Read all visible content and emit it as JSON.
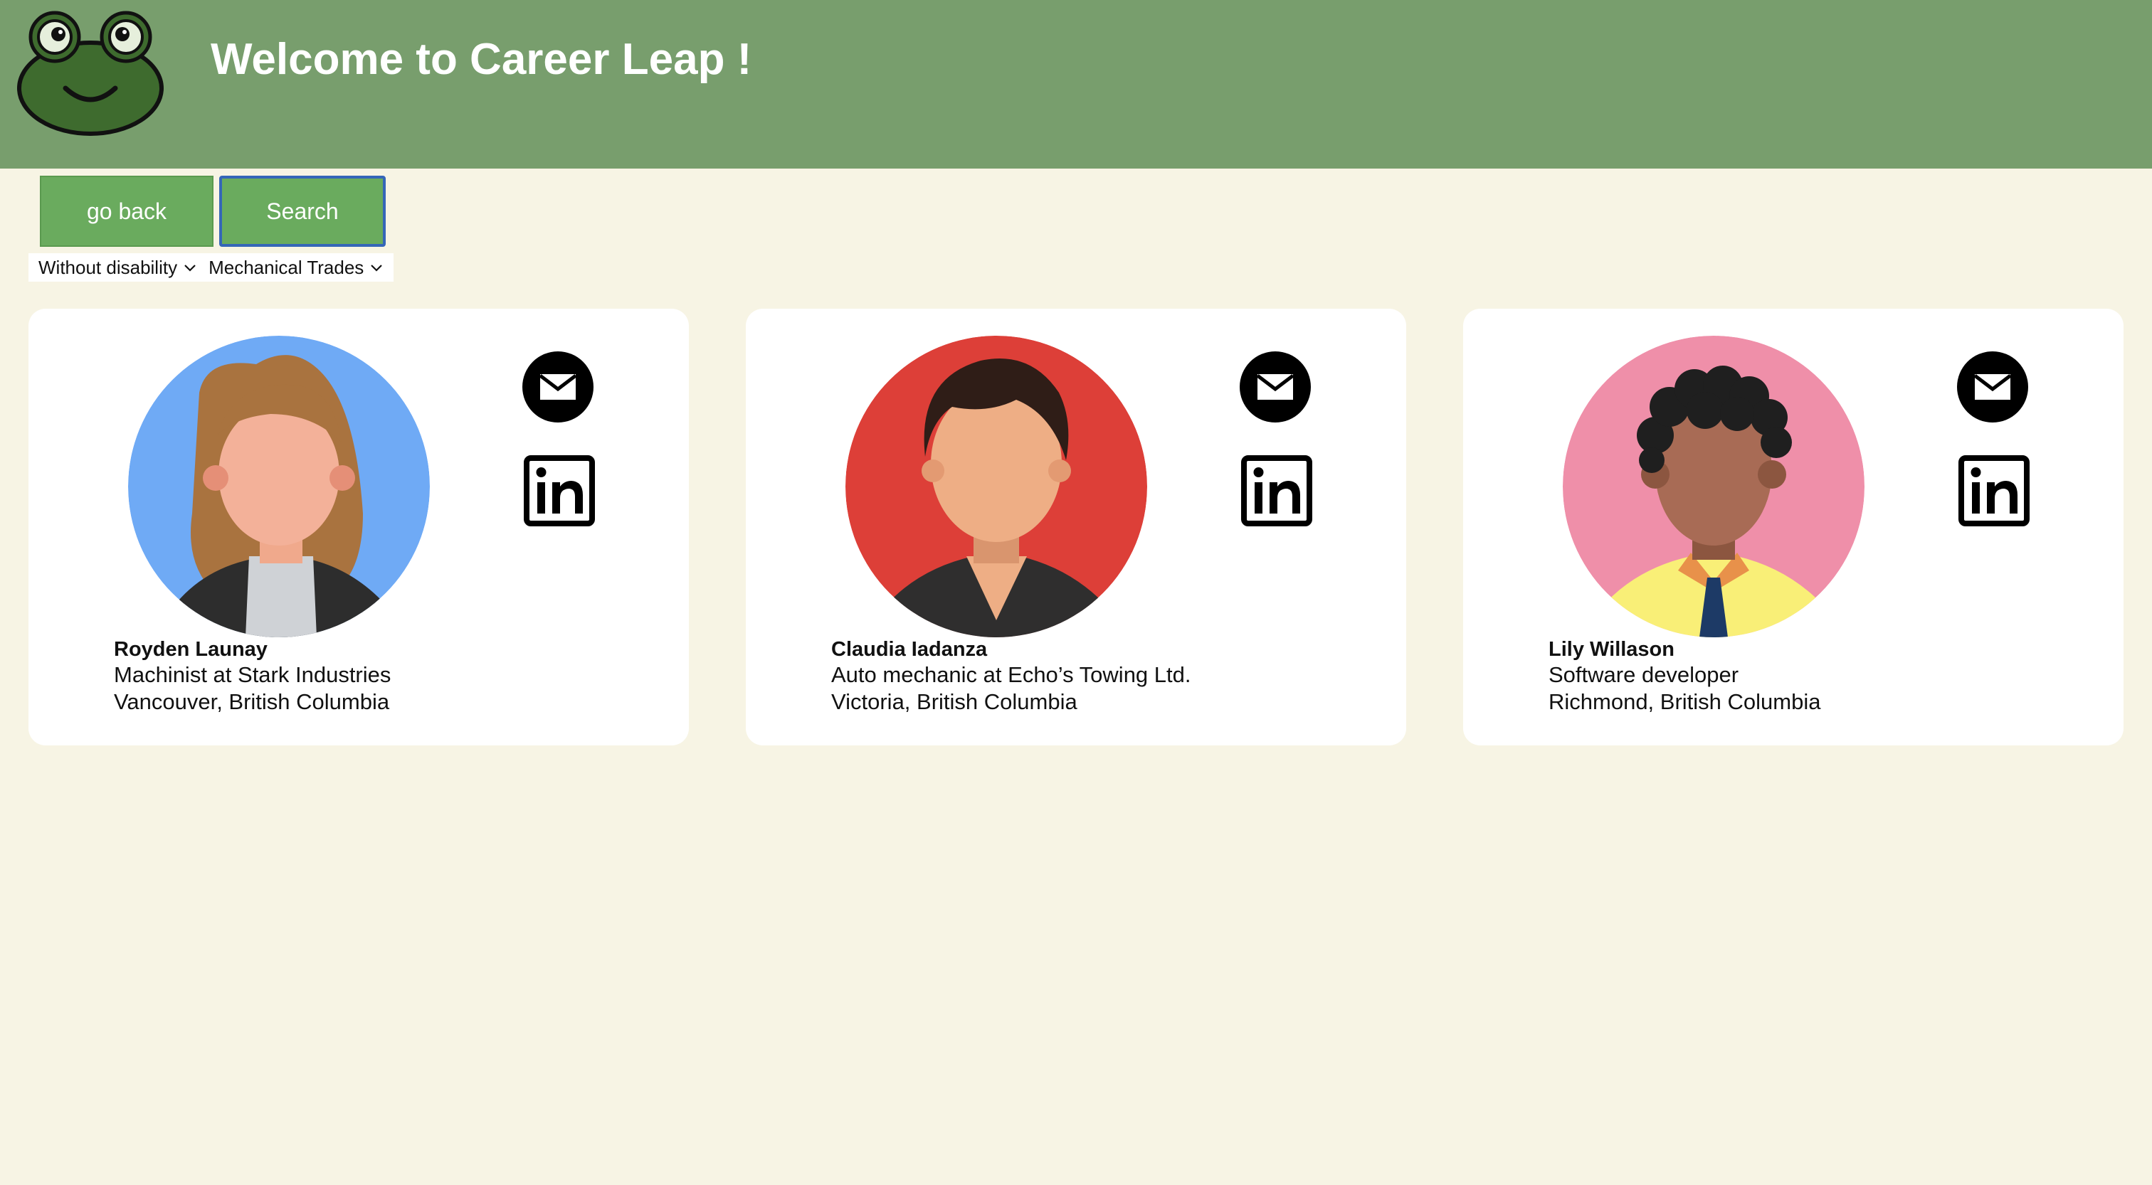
{
  "header": {
    "title": "Welcome to Career Leap !",
    "background": "#789e6d",
    "logo_icon": "frog-logo-icon"
  },
  "toolbar": {
    "back_label": "go back",
    "search_label": "Search",
    "button_color": "#6aab5e"
  },
  "filters": {
    "disability": "Without disability",
    "field": "Mechanical Trades"
  },
  "profiles": [
    {
      "name": "Royden Launay",
      "title": "Machinist at Stark Industries",
      "location": "Vancouver, British Columbia",
      "avatar_bg": "#6faaf5",
      "contact_icons": [
        "mail-icon",
        "linkedin-icon"
      ]
    },
    {
      "name": "Claudia Iadanza",
      "title": "Auto mechanic at Echo’s Towing Ltd.",
      "location": "Victoria, British Columbia",
      "avatar_bg": "#dd3f38",
      "contact_icons": [
        "mail-icon",
        "linkedin-icon"
      ]
    },
    {
      "name": "Lily Willason",
      "title": "Software developer",
      "location": "Richmond, British Columbia",
      "avatar_bg": "#ef8fa9",
      "contact_icons": [
        "mail-icon",
        "linkedin-icon"
      ]
    }
  ]
}
